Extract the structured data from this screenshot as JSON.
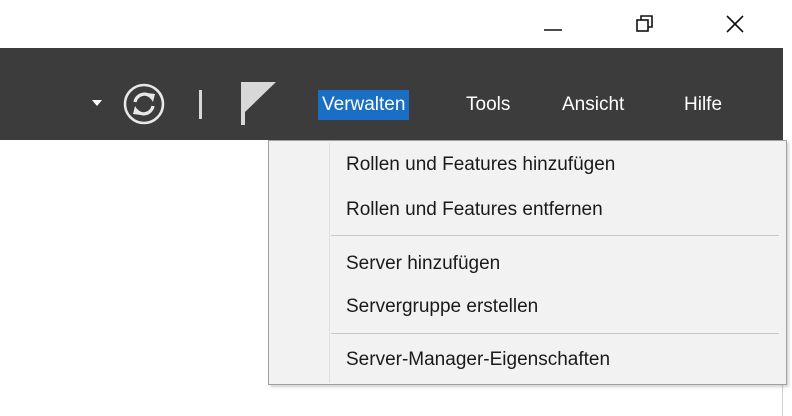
{
  "window_controls": {
    "minimize_icon": "minimize-icon",
    "restore_icon": "restore-icon",
    "close_icon": "close-icon"
  },
  "toolbar": {
    "background": "#3c3c3c",
    "icons": [
      "dropdown-arrow-icon",
      "refresh-icon",
      "flag-icon"
    ],
    "menu": [
      {
        "label": "Verwalten",
        "active": true
      },
      {
        "label": "Tools",
        "active": false
      },
      {
        "label": "Ansicht",
        "active": false
      },
      {
        "label": "Hilfe",
        "active": false
      }
    ],
    "active_color": "#1a6fc4"
  },
  "dropdown": {
    "groups": [
      [
        "Rollen und Features hinzufügen",
        "Rollen und Features entfernen"
      ],
      [
        "Server hinzufügen",
        "Servergruppe erstellen"
      ],
      [
        "Server-Manager-Eigenschaften"
      ]
    ]
  }
}
